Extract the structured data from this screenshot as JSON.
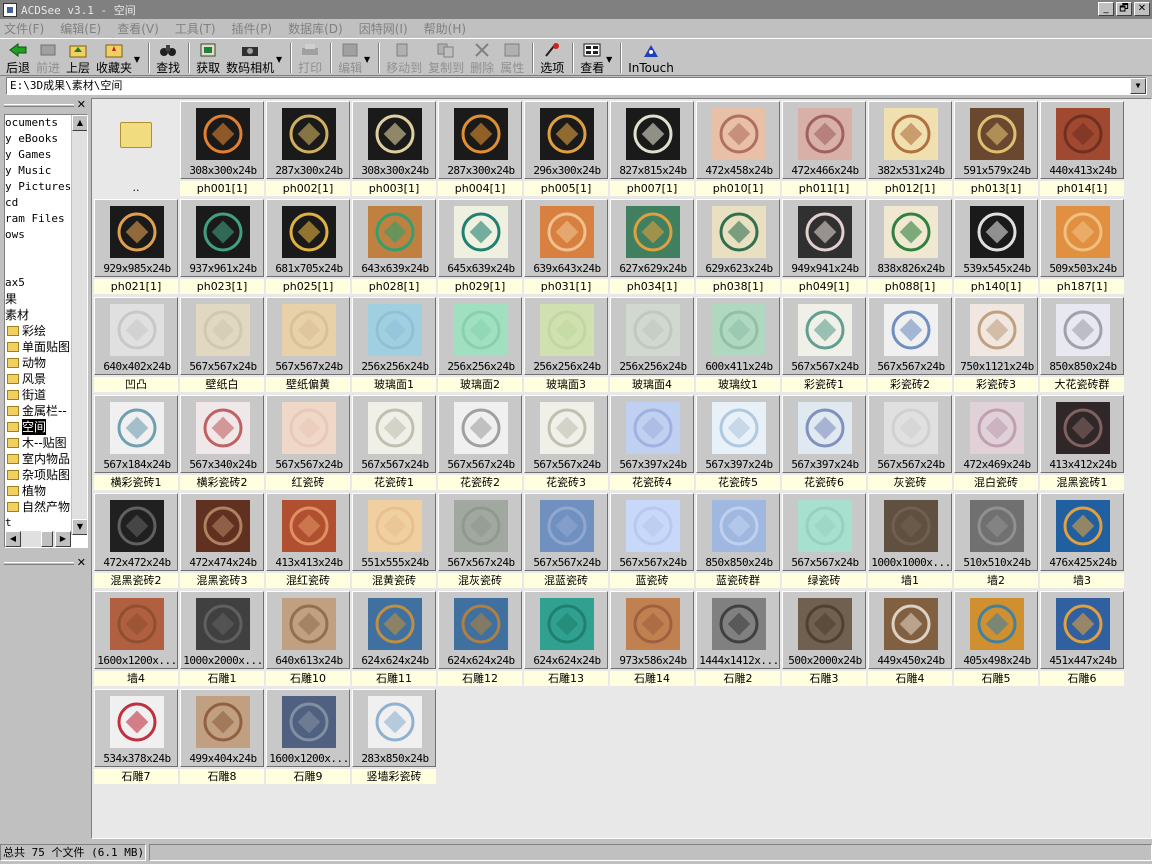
{
  "window": {
    "title": "ACDSee v3.1 - 空间",
    "min": "_",
    "restore": "🗗",
    "close": "✕"
  },
  "menu": [
    "文件(F)",
    "编辑(E)",
    "查看(V)",
    "工具(T)",
    "插件(P)",
    "数据库(D)",
    "因特网(I)",
    "帮助(H)"
  ],
  "toolbar": [
    {
      "label": "后退",
      "icon": "back-arrow-icon",
      "enabled": true
    },
    {
      "label": "前进",
      "icon": "forward-arrow-icon",
      "enabled": false
    },
    {
      "label": "上层",
      "icon": "up-folder-icon",
      "enabled": true
    },
    {
      "label": "收藏夹",
      "icon": "favorites-icon",
      "enabled": true,
      "dropdown": true
    },
    {
      "label": "查找",
      "icon": "binoculars-icon",
      "enabled": true
    },
    {
      "label": "获取",
      "icon": "acquire-icon",
      "enabled": true
    },
    {
      "label": "数码相机",
      "icon": "camera-icon",
      "enabled": true,
      "dropdown": true
    },
    {
      "label": "打印",
      "icon": "printer-icon",
      "enabled": false
    },
    {
      "label": "编辑",
      "icon": "edit-image-icon",
      "enabled": false,
      "dropdown": true
    },
    {
      "label": "移动到",
      "icon": "move-to-icon",
      "enabled": false
    },
    {
      "label": "复制到",
      "icon": "copy-to-icon",
      "enabled": false
    },
    {
      "label": "删除",
      "icon": "delete-x-icon",
      "enabled": false
    },
    {
      "label": "属性",
      "icon": "properties-icon",
      "enabled": false
    },
    {
      "label": "选项",
      "icon": "options-icon",
      "enabled": true
    },
    {
      "label": "查看",
      "icon": "view-icon",
      "enabled": true,
      "dropdown": true
    },
    {
      "label": "InTouch",
      "icon": "intouch-icon",
      "enabled": true
    }
  ],
  "address": "E:\\3D成果\\素材\\空间",
  "tree": [
    {
      "label": "ocuments",
      "folder": false
    },
    {
      "label": "y eBooks",
      "folder": false
    },
    {
      "label": "y Games",
      "folder": false
    },
    {
      "label": "y Music",
      "folder": false
    },
    {
      "label": "y Pictures",
      "folder": false
    },
    {
      "label": "cd",
      "folder": false
    },
    {
      "label": "ram Files",
      "folder": false
    },
    {
      "label": "ows",
      "folder": false
    },
    {
      "label": "",
      "folder": false
    },
    {
      "label": "",
      "folder": false
    },
    {
      "label": "ax5",
      "folder": false
    },
    {
      "label": "果",
      "folder": false,
      "cn": true
    },
    {
      "label": "素材",
      "folder": false,
      "cn": true
    },
    {
      "label": "彩绘",
      "folder": true
    },
    {
      "label": "单面贴图",
      "folder": true
    },
    {
      "label": "动物",
      "folder": true
    },
    {
      "label": "风景",
      "folder": true
    },
    {
      "label": "街道",
      "folder": true
    },
    {
      "label": "金属栏--",
      "folder": true
    },
    {
      "label": "空间",
      "folder": true,
      "selected": true
    },
    {
      "label": "木--贴图",
      "folder": true
    },
    {
      "label": "室内物品",
      "folder": true
    },
    {
      "label": "杂项贴图",
      "folder": true
    },
    {
      "label": "植物",
      "folder": true
    },
    {
      "label": "自然产物",
      "folder": true
    },
    {
      "label": "t",
      "folder": false
    }
  ],
  "up_item": "..",
  "files": [
    {
      "name": "ph001[1]",
      "dims": "308x300x24b",
      "bg": "#1a1a1a",
      "fg": "#e08030"
    },
    {
      "name": "ph002[1]",
      "dims": "287x300x24b",
      "bg": "#1a1a1a",
      "fg": "#d0b060"
    },
    {
      "name": "ph003[1]",
      "dims": "308x300x24b",
      "bg": "#1a1a1a",
      "fg": "#e0d0a0"
    },
    {
      "name": "ph004[1]",
      "dims": "287x300x24b",
      "bg": "#1a1a1a",
      "fg": "#e09030"
    },
    {
      "name": "ph005[1]",
      "dims": "296x300x24b",
      "bg": "#1a1a1a",
      "fg": "#e0a040"
    },
    {
      "name": "ph007[1]",
      "dims": "827x815x24b",
      "bg": "#1a1a1a",
      "fg": "#e0e0d0"
    },
    {
      "name": "ph010[1]",
      "dims": "472x458x24b",
      "bg": "#e8c0a8",
      "fg": "#b07060"
    },
    {
      "name": "ph011[1]",
      "dims": "472x466x24b",
      "bg": "#d8b0a8",
      "fg": "#a06060"
    },
    {
      "name": "ph012[1]",
      "dims": "382x531x24b",
      "bg": "#f0e0b0",
      "fg": "#b07040"
    },
    {
      "name": "ph013[1]",
      "dims": "591x579x24b",
      "bg": "#6a4830",
      "fg": "#e0c070"
    },
    {
      "name": "ph014[1]",
      "dims": "440x413x24b",
      "bg": "#a04830",
      "fg": "#703020"
    },
    {
      "name": "ph021[1]",
      "dims": "929x985x24b",
      "bg": "#1a1a1a",
      "fg": "#e0a050"
    },
    {
      "name": "ph023[1]",
      "dims": "937x961x24b",
      "bg": "#1a1a1a",
      "fg": "#40a080"
    },
    {
      "name": "ph025[1]",
      "dims": "681x705x24b",
      "bg": "#1a1a1a",
      "fg": "#e0b040"
    },
    {
      "name": "ph028[1]",
      "dims": "643x639x24b",
      "bg": "#c08040",
      "fg": "#30a070"
    },
    {
      "name": "ph029[1]",
      "dims": "645x639x24b",
      "bg": "#f0f0e0",
      "fg": "#208070"
    },
    {
      "name": "ph031[1]",
      "dims": "639x643x24b",
      "bg": "#d88040",
      "fg": "#f0c090"
    },
    {
      "name": "ph034[1]",
      "dims": "627x629x24b",
      "bg": "#408060",
      "fg": "#e0a040"
    },
    {
      "name": "ph038[1]",
      "dims": "629x623x24b",
      "bg": "#e8e0c0",
      "fg": "#307050"
    },
    {
      "name": "ph049[1]",
      "dims": "949x941x24b",
      "bg": "#303030",
      "fg": "#e0d0d0"
    },
    {
      "name": "ph088[1]",
      "dims": "838x826x24b",
      "bg": "#f0e8d0",
      "fg": "#308040"
    },
    {
      "name": "ph140[1]",
      "dims": "539x545x24b",
      "bg": "#1a1a1a",
      "fg": "#e0e0e0"
    },
    {
      "name": "ph187[1]",
      "dims": "509x503x24b",
      "bg": "#e09040",
      "fg": "#f0c080"
    },
    {
      "name": "凹凸",
      "dims": "640x402x24b",
      "bg": "#e0e0e0",
      "fg": "#c8c8c8"
    },
    {
      "name": "壁纸白",
      "dims": "567x567x24b",
      "bg": "#e0d8c0",
      "fg": "#d0c8b0"
    },
    {
      "name": "壁纸偏黄",
      "dims": "567x567x24b",
      "bg": "#e8d0a8",
      "fg": "#d8c098"
    },
    {
      "name": "玻璃面1",
      "dims": "256x256x24b",
      "bg": "#a0d0e0",
      "fg": "#90c0d8"
    },
    {
      "name": "玻璃面2",
      "dims": "256x256x24b",
      "bg": "#a0e0c0",
      "fg": "#88d0b0"
    },
    {
      "name": "玻璃面3",
      "dims": "256x256x24b",
      "bg": "#d0e0b0",
      "fg": "#c0d8a0"
    },
    {
      "name": "玻璃面4",
      "dims": "256x256x24b",
      "bg": "#d0d8d0",
      "fg": "#c0c8c0"
    },
    {
      "name": "玻璃纹1",
      "dims": "600x411x24b",
      "bg": "#b0d8c0",
      "fg": "#90c0a8"
    },
    {
      "name": "彩瓷砖1",
      "dims": "567x567x24b",
      "bg": "#f0f0e8",
      "fg": "#60a090"
    },
    {
      "name": "彩瓷砖2",
      "dims": "567x567x24b",
      "bg": "#f0f0f0",
      "fg": "#7090c0"
    },
    {
      "name": "彩瓷砖3",
      "dims": "750x1121x24b",
      "bg": "#f0e8e0",
      "fg": "#c0a080"
    },
    {
      "name": "大花瓷砖群",
      "dims": "850x850x24b",
      "bg": "#e8e8f0",
      "fg": "#a0a0b0"
    },
    {
      "name": "横彩瓷砖1",
      "dims": "567x184x24b",
      "bg": "#f0f0f0",
      "fg": "#70a0b0"
    },
    {
      "name": "横彩瓷砖2",
      "dims": "567x340x24b",
      "bg": "#f0e8e8",
      "fg": "#c06060"
    },
    {
      "name": "红瓷砖",
      "dims": "567x567x24b",
      "bg": "#f0d8c8",
      "fg": "#e8c8b8"
    },
    {
      "name": "花瓷砖1",
      "dims": "567x567x24b",
      "bg": "#f0f0e8",
      "fg": "#c0c0b0"
    },
    {
      "name": "花瓷砖2",
      "dims": "567x567x24b",
      "bg": "#f0f0f0",
      "fg": "#a0a0a0"
    },
    {
      "name": "花瓷砖3",
      "dims": "567x567x24b",
      "bg": "#f0f0e8",
      "fg": "#c0c0b0"
    },
    {
      "name": "花瓷砖4",
      "dims": "567x397x24b",
      "bg": "#c0d0f0",
      "fg": "#a0b0e0"
    },
    {
      "name": "花瓷砖5",
      "dims": "567x397x24b",
      "bg": "#e8f0f8",
      "fg": "#b0c8e0"
    },
    {
      "name": "花瓷砖6",
      "dims": "567x397x24b",
      "bg": "#e0e8f0",
      "fg": "#8090c0"
    },
    {
      "name": "灰瓷砖",
      "dims": "567x567x24b",
      "bg": "#e0e0e0",
      "fg": "#d0d0d0"
    },
    {
      "name": "混白瓷砖",
      "dims": "472x469x24b",
      "bg": "#e0d0d8",
      "fg": "#c0a0b0"
    },
    {
      "name": "混黑瓷砖1",
      "dims": "413x412x24b",
      "bg": "#302828",
      "fg": "#806060"
    },
    {
      "name": "混黑瓷砖2",
      "dims": "472x472x24b",
      "bg": "#202020",
      "fg": "#606060"
    },
    {
      "name": "混黑瓷砖3",
      "dims": "472x474x24b",
      "bg": "#603020",
      "fg": "#b08060"
    },
    {
      "name": "混红瓷砖",
      "dims": "413x413x24b",
      "bg": "#b05030",
      "fg": "#e09060"
    },
    {
      "name": "混黄瓷砖",
      "dims": "551x555x24b",
      "bg": "#f0d0a0",
      "fg": "#e8c090"
    },
    {
      "name": "混灰瓷砖",
      "dims": "567x567x24b",
      "bg": "#a0a8a0",
      "fg": "#909890"
    },
    {
      "name": "混蓝瓷砖",
      "dims": "567x567x24b",
      "bg": "#7090c0",
      "fg": "#90a8d0"
    },
    {
      "name": "蓝瓷砖",
      "dims": "567x567x24b",
      "bg": "#c8d8f8",
      "fg": "#b8c8f0"
    },
    {
      "name": "蓝瓷砖群",
      "dims": "850x850x24b",
      "bg": "#a0b8e0",
      "fg": "#c0d0f0"
    },
    {
      "name": "绿瓷砖",
      "dims": "567x567x24b",
      "bg": "#a8e0d0",
      "fg": "#98d0c0"
    },
    {
      "name": "墙1",
      "dims": "1000x1000x...",
      "bg": "#605040",
      "fg": "#706050"
    },
    {
      "name": "墙2",
      "dims": "510x510x24b",
      "bg": "#707070",
      "fg": "#909090"
    },
    {
      "name": "墙3",
      "dims": "476x425x24b",
      "bg": "#2060a0",
      "fg": "#e0a040"
    },
    {
      "name": "墙4",
      "dims": "1600x1200x...",
      "bg": "#b06040",
      "fg": "#905030"
    },
    {
      "name": "石雕1",
      "dims": "1000x2000x...",
      "bg": "#404040",
      "fg": "#606060"
    },
    {
      "name": "石雕10",
      "dims": "640x613x24b",
      "bg": "#c0a080",
      "fg": "#907050"
    },
    {
      "name": "石雕11",
      "dims": "624x624x24b",
      "bg": "#4070a0",
      "fg": "#c09040"
    },
    {
      "name": "石雕12",
      "dims": "624x624x24b",
      "bg": "#4070a0",
      "fg": "#b08040"
    },
    {
      "name": "石雕13",
      "dims": "624x624x24b",
      "bg": "#30a090",
      "fg": "#208070"
    },
    {
      "name": "石雕14",
      "dims": "973x586x24b",
      "bg": "#c08050",
      "fg": "#a06040"
    },
    {
      "name": "石雕2",
      "dims": "1444x1412x...",
      "bg": "#808080",
      "fg": "#404040"
    },
    {
      "name": "石雕3",
      "dims": "500x2000x24b",
      "bg": "#706050",
      "fg": "#504030"
    },
    {
      "name": "石雕4",
      "dims": "449x450x24b",
      "bg": "#806040",
      "fg": "#e0d0c0"
    },
    {
      "name": "石雕5",
      "dims": "405x498x24b",
      "bg": "#d09030",
      "fg": "#4080a0"
    },
    {
      "name": "石雕6",
      "dims": "451x447x24b",
      "bg": "#3060a0",
      "fg": "#e0a040"
    },
    {
      "name": "石雕7",
      "dims": "534x378x24b",
      "bg": "#f0f0f0",
      "fg": "#c03040"
    },
    {
      "name": "石雕8",
      "dims": "499x404x24b",
      "bg": "#c0a080",
      "fg": "#906040"
    },
    {
      "name": "石雕9",
      "dims": "1600x1200x...",
      "bg": "#506080",
      "fg": "#8090a0"
    },
    {
      "name": "竖墙彩瓷砖",
      "dims": "283x850x24b",
      "bg": "#f0f0f0",
      "fg": "#90b0d0"
    }
  ],
  "status": {
    "count": "总共 75 个文件 (6.1 MB)",
    "extra": ""
  }
}
